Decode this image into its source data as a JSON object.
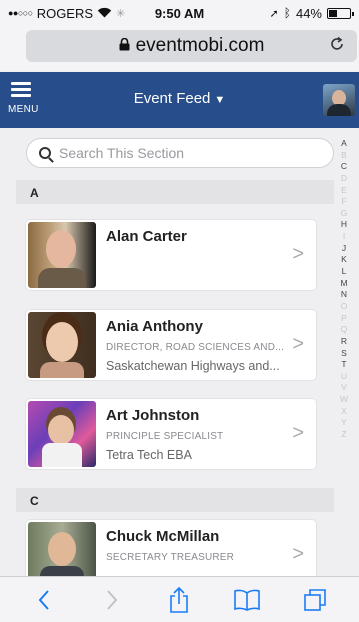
{
  "status_bar": {
    "signal": "●●○○○",
    "carrier": "ROGERS",
    "time": "9:50 AM",
    "battery_percent": "44%",
    "battery_level": 0.44
  },
  "browser": {
    "url": "eventmobi.com",
    "lock_icon": "lock-icon",
    "reload_icon": "reload-icon"
  },
  "header": {
    "menu_label": "MENU",
    "feed_title": "Event Feed",
    "brand_color": "#274e8a"
  },
  "search": {
    "placeholder": "Search This Section"
  },
  "sections": [
    {
      "letter": "A",
      "people": [
        {
          "name": "Alan Carter",
          "title": "",
          "org": ""
        },
        {
          "name": "Ania Anthony",
          "title": "DIRECTOR, ROAD SCIENCES AND...",
          "org": "Saskatchewan Highways and..."
        },
        {
          "name": "Art Johnston",
          "title": "PRINCIPLE SPECIALIST",
          "org": "Tetra Tech EBA"
        }
      ]
    },
    {
      "letter": "C",
      "people": [
        {
          "name": "Chuck McMillan",
          "title": "SECRETARY TREASURER",
          "org": ""
        }
      ]
    }
  ],
  "alphabet_index": {
    "letters": [
      "A",
      "B",
      "C",
      "D",
      "E",
      "F",
      "G",
      "H",
      "I",
      "J",
      "K",
      "L",
      "M",
      "N",
      "O",
      "P",
      "Q",
      "R",
      "S",
      "T",
      "U",
      "V",
      "W",
      "X",
      "Y",
      "Z"
    ],
    "active": [
      "A",
      "C",
      "H",
      "J",
      "K",
      "L",
      "M",
      "N",
      "R",
      "S",
      "T"
    ]
  },
  "toolbar": {
    "back_icon": "chevron-left-icon",
    "forward_icon": "chevron-right-icon",
    "share_icon": "share-icon",
    "bookmarks_icon": "book-icon",
    "tabs_icon": "tabs-icon",
    "accent_color": "#1a7cf5"
  }
}
